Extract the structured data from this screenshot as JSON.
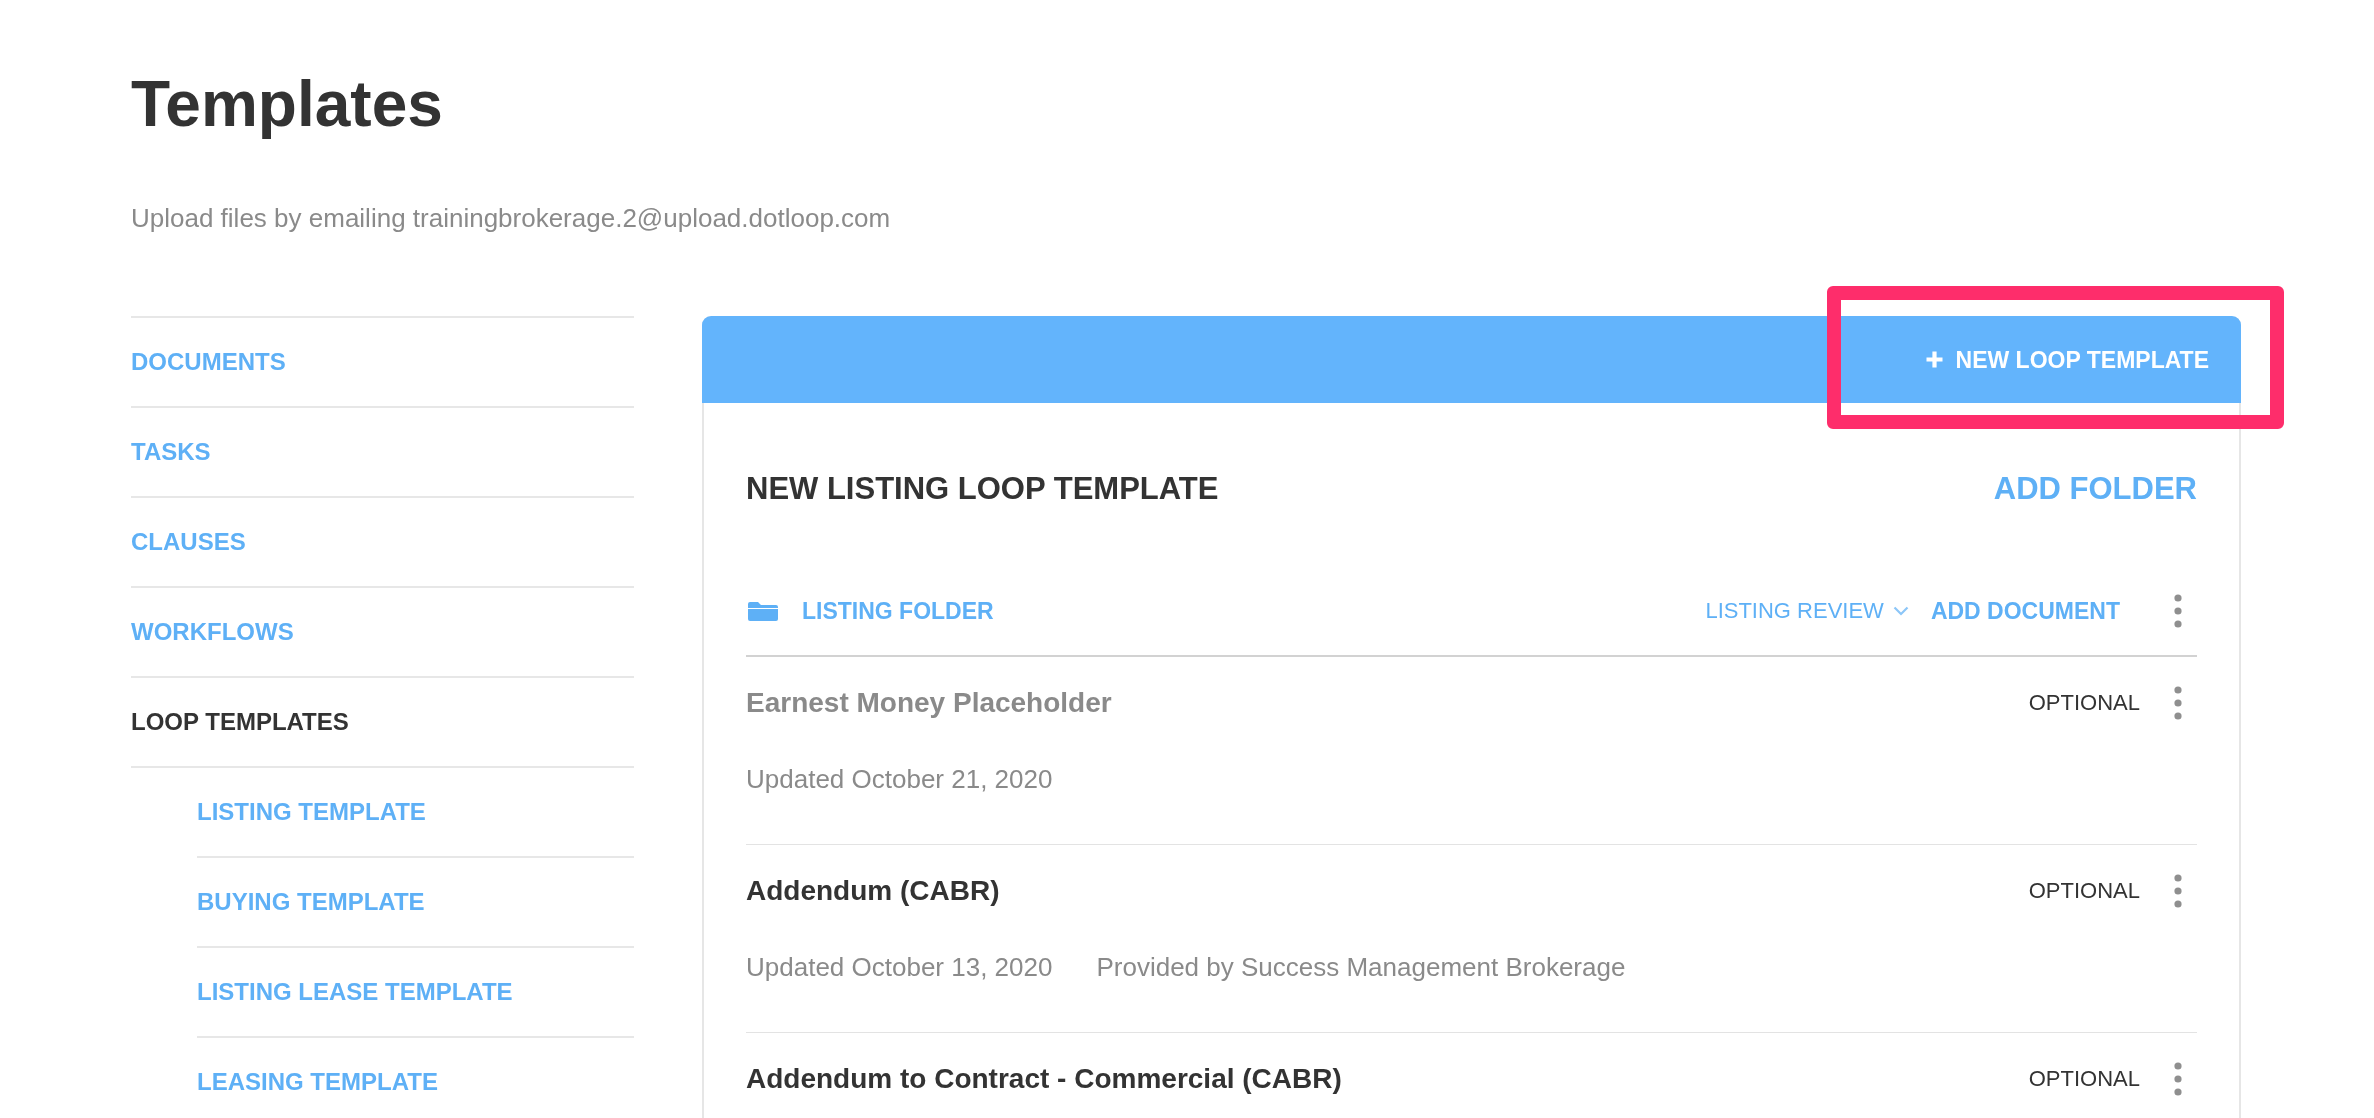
{
  "page": {
    "title": "Templates",
    "subtitle": "Upload files by emailing trainingbrokerage.2@upload.dotloop.com"
  },
  "sidebar": {
    "items": [
      {
        "label": "DOCUMENTS",
        "selected": false
      },
      {
        "label": "TASKS",
        "selected": false
      },
      {
        "label": "CLAUSES",
        "selected": false
      },
      {
        "label": "WORKFLOWS",
        "selected": false
      },
      {
        "label": "LOOP TEMPLATES",
        "selected": true,
        "children": [
          {
            "label": "LISTING TEMPLATE",
            "selected": false
          },
          {
            "label": "BUYING TEMPLATE",
            "selected": false
          },
          {
            "label": "LISTING LEASE TEMPLATE",
            "selected": false
          },
          {
            "label": "LEASING TEMPLATE",
            "selected": false
          }
        ]
      }
    ]
  },
  "header_bar": {
    "button": {
      "label": "NEW LOOP TEMPLATE",
      "highlighted": true
    }
  },
  "template": {
    "title": "NEW LISTING LOOP TEMPLATE",
    "add_folder": "ADD FOLDER",
    "folders": [
      {
        "name": "LISTING FOLDER",
        "review": "LISTING REVIEW",
        "add_document": "ADD DOCUMENT",
        "documents": [
          {
            "kind": "placeholder",
            "title": "Earnest Money Placeholder",
            "status": "OPTIONAL",
            "updated": "Updated October 21, 2020"
          },
          {
            "kind": "document",
            "title": "Addendum (CABR)",
            "status": "OPTIONAL",
            "updated": "Updated October 13, 2020",
            "provider": "Provided by Success Management Brokerage"
          },
          {
            "kind": "document",
            "title": "Addendum to Contract - Commercial (CABR)",
            "status": "OPTIONAL"
          }
        ]
      }
    ]
  }
}
